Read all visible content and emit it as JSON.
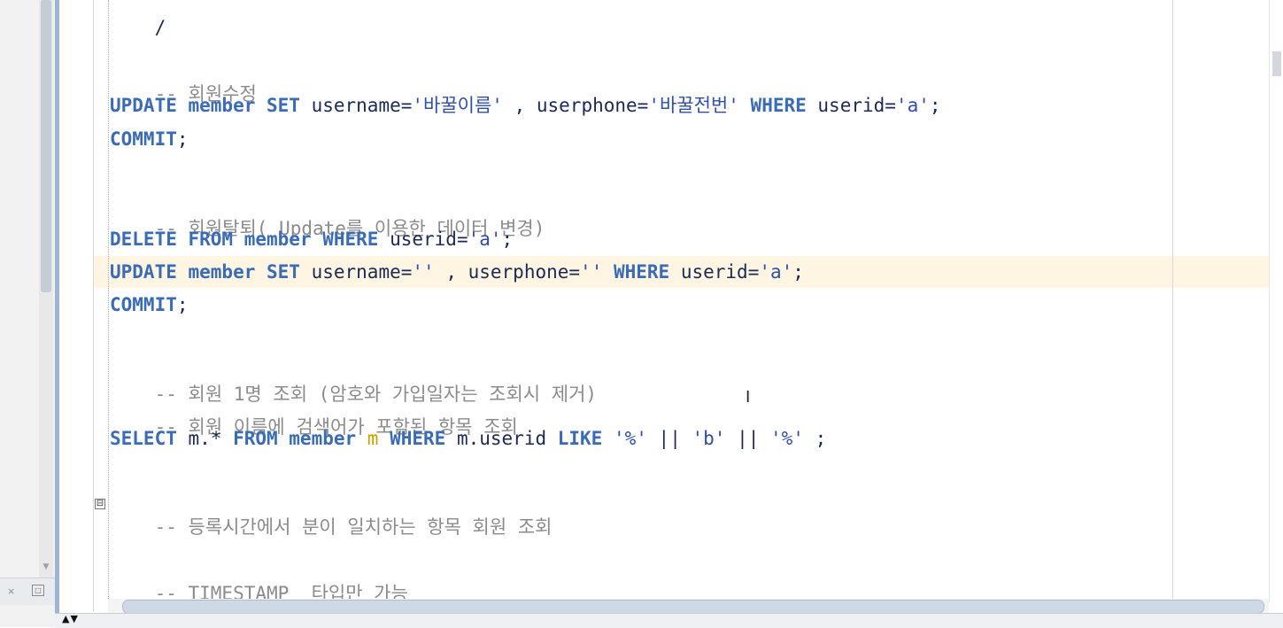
{
  "left_panel": {
    "close_glyph": "×",
    "minimize_glyph": "□",
    "scroll_down_glyph": "▼"
  },
  "editor": {
    "lines": {
      "l0": {
        "text": "/"
      },
      "l1": {
        "comment": "-- 회원수정"
      },
      "l2": {
        "kw1": "UPDATE member SET",
        "p1": " username=",
        "s1": "'바꿀이름'",
        "p2": " , userphone=",
        "s2": "'바꿀전번'",
        "kw2": " WHERE",
        "p3": " userid=",
        "s3": "'a'",
        "p4": ";"
      },
      "l3": {
        "kw1": "COMMIT",
        "p1": ";"
      },
      "l4": {
        "comment": "-- 회원탈퇴( Update를 이용한 데이터 변경)"
      },
      "l5": {
        "kw1": "DELETE FROM member WHERE",
        "p1": " userid=",
        "s1": "'a'",
        "p2": ";"
      },
      "l6": {
        "kw1": "UPDATE member SET",
        "p1": " username=",
        "s1": "''",
        "p2": " , userphone=",
        "s2": "''",
        "kw2": " WHERE",
        "p3": " userid=",
        "s3": "'a'",
        "p4": ";"
      },
      "l7": {
        "kw1": "COMMIT",
        "p1": ";"
      },
      "l8": {
        "comment": "-- 회원 1명 조회 (암호와 가입일자는 조회시 제거)"
      },
      "l9": {
        "comment": "-- 회원 이름에 검색어가 포함된 항목 조회"
      },
      "l10": {
        "kw1": "SELECT",
        "p1": " m.* ",
        "kw2": "FROM member",
        "alias": " m",
        "kw3": " WHERE",
        "p2": " m.userid ",
        "kw4": "LIKE",
        "s1": " '%'",
        "p3": " || ",
        "s2": "'b'",
        "p4": " || ",
        "s3": "'%'",
        "p5": " ;"
      },
      "l11": {
        "comment": "-- 등록시간에서 분이 일치하는 항목 회원 조회"
      },
      "l12": {
        "comment": "-- TIMESTAMP  타입만 가능"
      }
    },
    "fold_glyph": "⊟",
    "cursor_glyph": "I"
  },
  "bottom": {
    "arrows": "▲▼"
  }
}
